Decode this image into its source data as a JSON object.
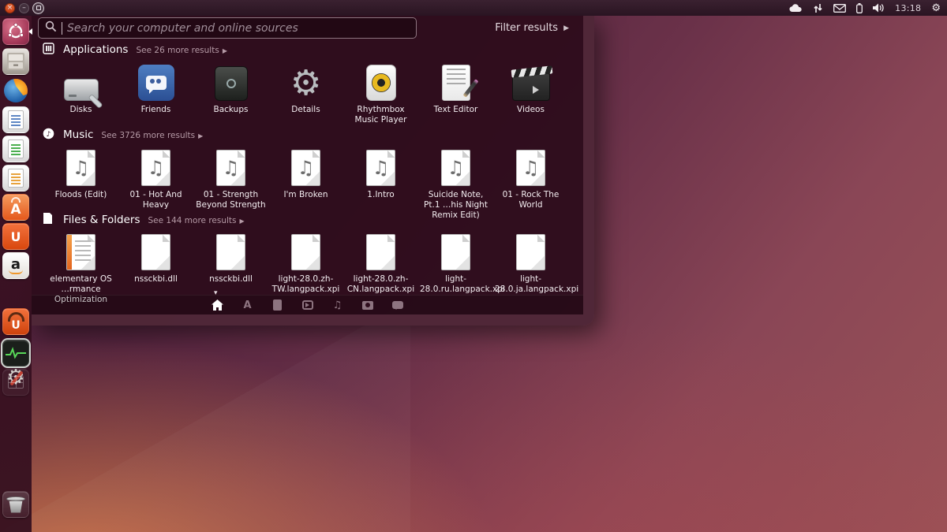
{
  "panel": {
    "window_controls": [
      "close",
      "minimize",
      "maximize"
    ],
    "tray_icons": [
      "cloud-icon",
      "sync-arrows-icon",
      "mail-envelope-icon",
      "battery-icon",
      "volume-icon",
      "session-gear-icon"
    ],
    "time": "13:18"
  },
  "launcher": {
    "items": [
      "ubuntu-dash",
      "files",
      "firefox",
      "libreoffice-writer",
      "libreoffice-calc",
      "libreoffice-impress",
      "software-center",
      "ubuntu-one",
      "amazon",
      "ubuntu-one-music",
      "system-settings",
      "system-monitor",
      "workspace-switcher",
      "trash"
    ],
    "software_center_letter": "A",
    "ubuntu_one_letter": "U",
    "amazon_letter": "a",
    "u1_music_letter": "U",
    "settings_glyph": "⚙"
  },
  "dash": {
    "search": {
      "placeholder": "Search your computer and online sources"
    },
    "filter_label": "Filter results",
    "filter_arrow": "▶",
    "scroll_caret": "▾",
    "sections": [
      {
        "title": "Applications",
        "more": "See 26 more results",
        "arrow": "▶",
        "items": [
          {
            "label": "Disks"
          },
          {
            "label": "Friends"
          },
          {
            "label": "Backups"
          },
          {
            "label": "Details"
          },
          {
            "label": "Rhythmbox Music Player"
          },
          {
            "label": "Text Editor"
          },
          {
            "label": "Videos"
          }
        ]
      },
      {
        "title": "Music",
        "more": "See 3726 more results",
        "arrow": "▶",
        "items": [
          {
            "label": "Floods (Edit)"
          },
          {
            "label": "01 - Hot And Heavy"
          },
          {
            "label": "01 - Strength Beyond Strength"
          },
          {
            "label": "I'm Broken"
          },
          {
            "label": "1.Intro"
          },
          {
            "label": "Suicide Note, Pt.1 …his Night Remix Edit)"
          },
          {
            "label": "01 - Rock The World"
          }
        ]
      },
      {
        "title": "Files & Folders",
        "more": "See 144 more results",
        "arrow": "▶",
        "items": [
          {
            "label": "elementary OS …rmance Optimization"
          },
          {
            "label": "nssckbi.dll"
          },
          {
            "label": "nssckbi.dll"
          },
          {
            "label": "light-28.0.zh-TW.langpack.xpi"
          },
          {
            "label": "light-28.0.zh-CN.langpack.xpi"
          },
          {
            "label": "light-28.0.ru.langpack.xpi"
          },
          {
            "label": "light-28.0.ja.langpack.xpi"
          }
        ]
      }
    ],
    "lenses": [
      "home",
      "applications",
      "files",
      "videos",
      "music",
      "photos",
      "social"
    ],
    "music_note_glyph": "♫",
    "lens_apps_letter": "A",
    "lens_home_glyph": "⌂",
    "lens_music_glyph": "♫"
  }
}
